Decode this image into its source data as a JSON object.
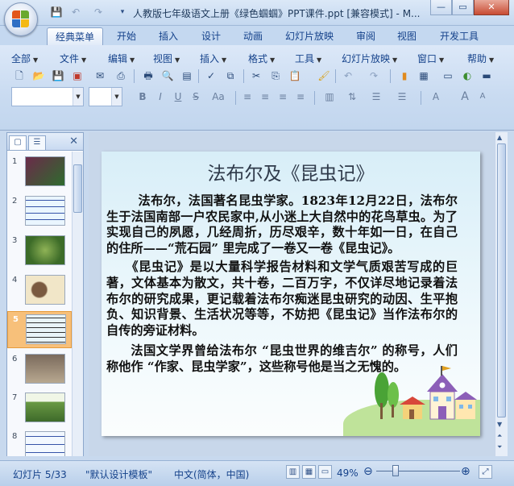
{
  "window": {
    "title": "人教版七年级语文上册《绿色蝈蝈》PPT课件.ppt [兼容模式] - M...",
    "controls": [
      "—",
      "▭",
      "✕"
    ]
  },
  "quick_access": [
    "save-icon",
    "undo-icon",
    "redo-icon",
    "customize-icon"
  ],
  "ribbon_tabs": [
    {
      "label": "经典菜单",
      "active": true
    },
    {
      "label": "开始"
    },
    {
      "label": "插入"
    },
    {
      "label": "设计"
    },
    {
      "label": "动画"
    },
    {
      "label": "幻灯片放映"
    },
    {
      "label": "审阅"
    },
    {
      "label": "视图"
    },
    {
      "label": "开发工具"
    }
  ],
  "menus": [
    "全部",
    "文件",
    "编辑",
    "视图",
    "插入",
    "格式",
    "工具",
    "幻灯片放映",
    "窗口",
    "帮助"
  ],
  "format_buttons": [
    "B",
    "I",
    "U",
    "S",
    "Aa"
  ],
  "slides_pane": {
    "tabs": [
      "slides-tab",
      "outline-tab"
    ],
    "thumbs": [
      {
        "num": "1"
      },
      {
        "num": "2"
      },
      {
        "num": "3"
      },
      {
        "num": "4"
      },
      {
        "num": "5",
        "selected": true
      },
      {
        "num": "6"
      },
      {
        "num": "7"
      },
      {
        "num": "8"
      }
    ]
  },
  "slide": {
    "title": "法布尔及《昆虫记》",
    "paragraphs": [
      "法布尔，法国著名昆虫学家。1823年12月22日，法布尔生于法国南部一户农民家中,从小迷上大自然中的花鸟草虫。为了实现自己的夙愿，几经周折，历尽艰辛，数十年如一日，在自己的住所——“荒石园” 里完成了一卷又一卷《昆虫记》。",
      "《昆虫记》是以大量科学报告材料和文学气质艰苦写成的巨著，文体基本为散文，共十卷，二百万字，不仅详尽地记录着法布尔的研究成果，更记载着法布尔痴迷昆虫研究的动因、生平抱负、知识背景、生活状况等等，不妨把《昆虫记》当作法布尔的自传的旁证材料。",
      "法国文学界曾给法布尔 “昆虫世界的维吉尔” 的称号，人们称他作 “作家、昆虫学家”，这些称号他是当之无愧的。"
    ]
  },
  "status": {
    "slide_info": "幻灯片 5/33",
    "template": "\"默认设计模板\"",
    "language": "中文(简体，中国)",
    "zoom": "49%",
    "zoom_minus": "⊖",
    "zoom_plus": "⊕"
  }
}
